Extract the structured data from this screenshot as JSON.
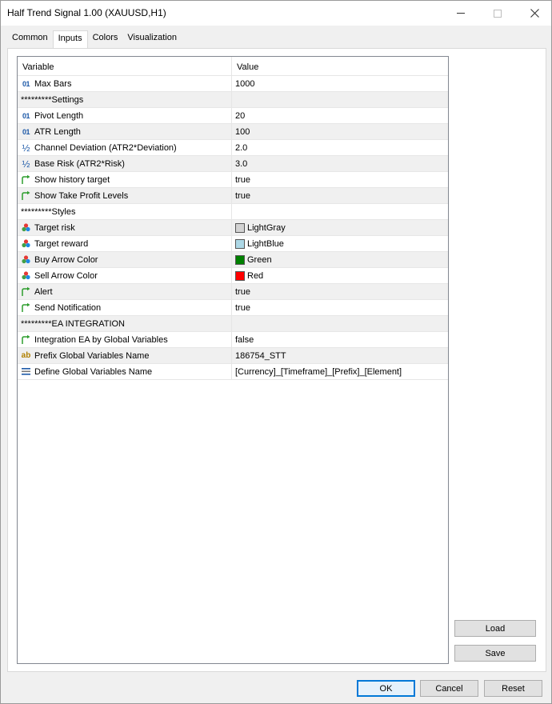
{
  "window": {
    "title": "Half Trend Signal 1.00 (XAUUSD,H1)"
  },
  "tabs": [
    {
      "label": "Common",
      "active": false
    },
    {
      "label": "Inputs",
      "active": true
    },
    {
      "label": "Colors",
      "active": false
    },
    {
      "label": "Visualization",
      "active": false
    }
  ],
  "grid": {
    "header_variable": "Variable",
    "header_value": "Value",
    "rows": [
      {
        "icon": "int",
        "variable": "Max Bars",
        "value": "1000"
      },
      {
        "icon": "none",
        "variable": "*********Settings",
        "value": ""
      },
      {
        "icon": "int",
        "variable": "Pivot Length",
        "value": "20"
      },
      {
        "icon": "int",
        "variable": "ATR Length",
        "value": "100"
      },
      {
        "icon": "double",
        "variable": "Channel Deviation (ATR2*Deviation)",
        "value": "2.0"
      },
      {
        "icon": "double",
        "variable": "Base Risk (ATR2*Risk)",
        "value": "3.0"
      },
      {
        "icon": "bool",
        "variable": "Show history target",
        "value": "true"
      },
      {
        "icon": "bool",
        "variable": "Show Take Profit Levels",
        "value": "true"
      },
      {
        "icon": "none",
        "variable": "*********Styles",
        "value": ""
      },
      {
        "icon": "color",
        "variable": "Target risk",
        "value": "LightGray",
        "swatch": "#d3d3d3"
      },
      {
        "icon": "color",
        "variable": "Target reward",
        "value": "LightBlue",
        "swatch": "#add8e6"
      },
      {
        "icon": "color",
        "variable": "Buy Arrow Color",
        "value": "Green",
        "swatch": "#008000"
      },
      {
        "icon": "color",
        "variable": "Sell Arrow Color",
        "value": "Red",
        "swatch": "#ff0000"
      },
      {
        "icon": "bool",
        "variable": "Alert",
        "value": "true"
      },
      {
        "icon": "bool",
        "variable": "Send Notification",
        "value": "true"
      },
      {
        "icon": "none",
        "variable": "*********EA INTEGRATION",
        "value": ""
      },
      {
        "icon": "bool",
        "variable": "Integration EA by Global Variables",
        "value": "false"
      },
      {
        "icon": "string",
        "variable": "Prefix Global Variables Name",
        "value": "186754_STT"
      },
      {
        "icon": "enum",
        "variable": "Define Global Variables Name",
        "value": "[Currency]_[Timeframe]_[Prefix]_[Element]"
      }
    ]
  },
  "buttons": {
    "load": "Load",
    "save": "Save",
    "ok": "OK",
    "cancel": "Cancel",
    "reset": "Reset"
  },
  "icons": {
    "int": "01",
    "double": "½",
    "string": "ab"
  },
  "colors": {
    "accent": "#0078d7",
    "bool_icon": "#2e9d2e"
  }
}
